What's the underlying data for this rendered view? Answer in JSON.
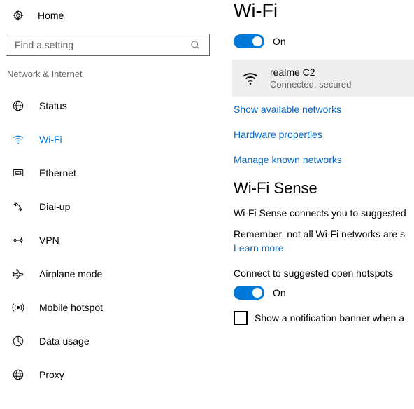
{
  "sidebar": {
    "home_label": "Home",
    "search_placeholder": "Find a setting",
    "section_label": "Network & Internet",
    "items": [
      {
        "label": "Status"
      },
      {
        "label": "Wi-Fi"
      },
      {
        "label": "Ethernet"
      },
      {
        "label": "Dial-up"
      },
      {
        "label": "VPN"
      },
      {
        "label": "Airplane mode"
      },
      {
        "label": "Mobile hotspot"
      },
      {
        "label": "Data usage"
      },
      {
        "label": "Proxy"
      }
    ]
  },
  "main": {
    "title": "Wi-Fi",
    "wifi_toggle_label": "On",
    "network": {
      "name": "realme C2",
      "status": "Connected, secured"
    },
    "links": {
      "show_available": "Show available networks",
      "hardware_props": "Hardware properties",
      "manage_known": "Manage known networks",
      "learn_more": "Learn more"
    },
    "sense": {
      "heading": "Wi-Fi Sense",
      "desc1": "Wi-Fi Sense connects you to suggested",
      "desc2": "Remember, not all Wi-Fi networks are s",
      "connect_suggested_label": "Connect to suggested open hotspots",
      "hotspot_toggle_label": "On",
      "notification_label": "Show a notification banner when a"
    }
  }
}
